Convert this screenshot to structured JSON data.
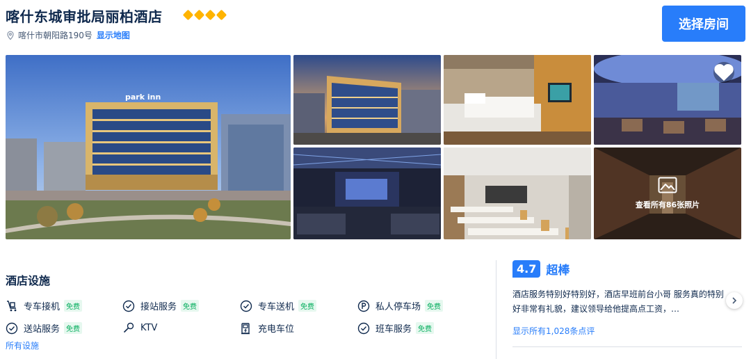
{
  "header": {
    "title": "喀什东城审批局丽柏酒店",
    "star_count": 4,
    "star_color": "#ffb400",
    "address": "喀什市朝阳路190号",
    "map_link": "显示地图",
    "select_room": "选择房间",
    "accent_color": "#287dfa"
  },
  "gallery": {
    "photos": [
      "hotel-exterior-main",
      "hotel-exterior-dusk",
      "guest-room",
      "lounge-bar",
      "ktv-lounge",
      "meeting-room",
      "corridor"
    ],
    "view_all": "查看所有86张照片",
    "icons": [
      "heart-icon",
      "image-icon"
    ]
  },
  "facilities": {
    "title": "酒店设施",
    "free_label": "免费",
    "items": [
      {
        "label": "专车接机",
        "icon": "luggage-cart-icon",
        "free": true
      },
      {
        "label": "接站服务",
        "icon": "check-circle-icon",
        "free": true
      },
      {
        "label": "专车送机",
        "icon": "check-circle-icon",
        "free": true
      },
      {
        "label": "私人停车场",
        "icon": "parking-icon",
        "free": true
      },
      {
        "label": "送站服务",
        "icon": "check-circle-icon",
        "free": true
      },
      {
        "label": "KTV",
        "icon": "microphone-icon",
        "free": false
      },
      {
        "label": "充电车位",
        "icon": "charging-station-icon",
        "free": false
      },
      {
        "label": "班车服务",
        "icon": "check-circle-icon",
        "free": true
      }
    ],
    "all_link": "所有设施"
  },
  "reviews": {
    "score": "4.7",
    "score_word": "超棒",
    "text": "酒店服务特别好特别好，酒店早班前台小哥 服务真的特别好非常有礼貌，建议领导给他提高点工资，…",
    "all_link": "显示所有1,028条点评"
  }
}
